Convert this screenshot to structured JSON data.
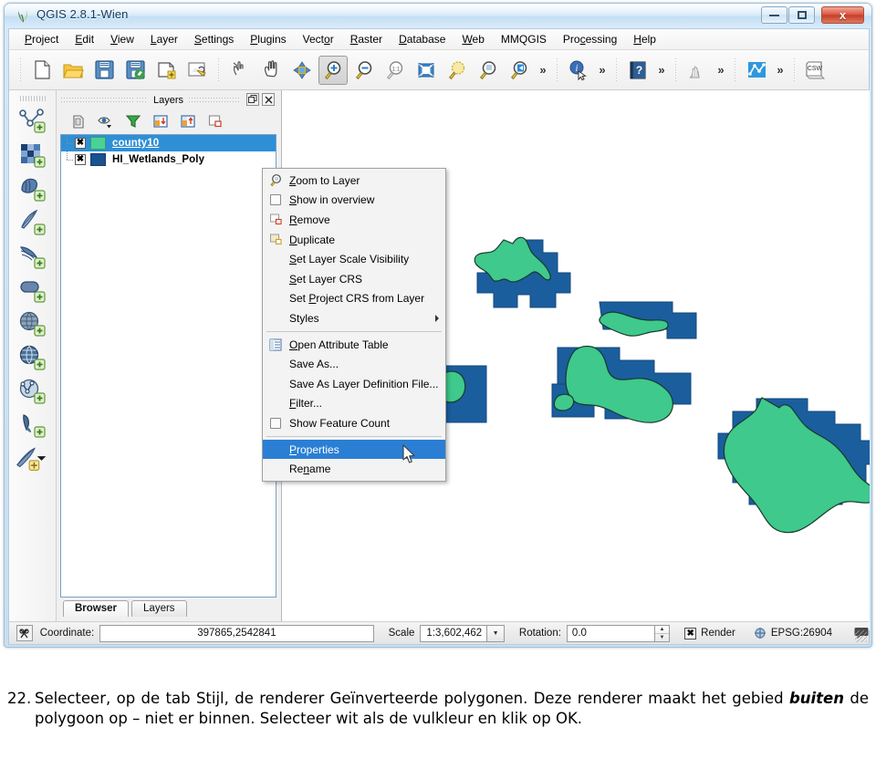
{
  "window": {
    "title": "QGIS 2.8.1-Wien",
    "app_icon": "qgis-logo-icon",
    "minimize_label": "",
    "maximize_label": "",
    "close_label": "x"
  },
  "menu_bar": {
    "items": [
      {
        "label": "Project",
        "mnemonic": "P"
      },
      {
        "label": "Edit",
        "mnemonic": "E"
      },
      {
        "label": "View",
        "mnemonic": "V"
      },
      {
        "label": "Layer",
        "mnemonic": "L"
      },
      {
        "label": "Settings",
        "mnemonic": "S"
      },
      {
        "label": "Plugins",
        "mnemonic": "P"
      },
      {
        "label": "Vector",
        "mnemonic": "o"
      },
      {
        "label": "Raster",
        "mnemonic": "R"
      },
      {
        "label": "Database",
        "mnemonic": "D"
      },
      {
        "label": "Web",
        "mnemonic": "W"
      },
      {
        "label": "MMQGIS",
        "mnemonic": ""
      },
      {
        "label": "Processing",
        "mnemonic": "c"
      },
      {
        "label": "Help",
        "mnemonic": "H"
      }
    ]
  },
  "toolbar": {
    "items": [
      {
        "name": "new-project-icon",
        "type": "icon"
      },
      {
        "name": "open-project-icon",
        "type": "icon"
      },
      {
        "name": "save-project-icon",
        "type": "icon"
      },
      {
        "name": "save-project-as-icon",
        "type": "icon"
      },
      {
        "name": "new-print-composer-icon",
        "type": "icon"
      },
      {
        "name": "composer-manager-icon",
        "type": "icon"
      },
      {
        "name": "separator",
        "type": "sep"
      },
      {
        "name": "touch-zoom-icon",
        "type": "icon"
      },
      {
        "name": "pan-map-icon",
        "type": "icon"
      },
      {
        "name": "pan-to-selection-icon",
        "type": "icon"
      },
      {
        "name": "zoom-in-icon",
        "type": "icon",
        "active": true
      },
      {
        "name": "zoom-out-icon",
        "type": "icon"
      },
      {
        "name": "zoom-native-icon",
        "type": "icon"
      },
      {
        "name": "zoom-full-icon",
        "type": "icon"
      },
      {
        "name": "zoom-to-selection-icon",
        "type": "icon"
      },
      {
        "name": "zoom-to-layer-icon",
        "type": "icon"
      },
      {
        "name": "zoom-last-icon",
        "type": "icon"
      },
      {
        "name": "overflow-chevron",
        "type": "chev"
      },
      {
        "name": "separator",
        "type": "sep"
      },
      {
        "name": "identify-features-icon",
        "type": "icon"
      },
      {
        "name": "overflow-chevron",
        "type": "chev"
      },
      {
        "name": "separator",
        "type": "sep"
      },
      {
        "name": "help-contents-icon",
        "type": "icon"
      },
      {
        "name": "overflow-chevron",
        "type": "chev"
      },
      {
        "name": "separator",
        "type": "sep"
      },
      {
        "name": "histogram-icon",
        "type": "icon"
      },
      {
        "name": "overflow-chevron",
        "type": "chev"
      },
      {
        "name": "separator",
        "type": "sep"
      },
      {
        "name": "graph-tool-icon",
        "type": "icon"
      },
      {
        "name": "overflow-chevron",
        "type": "chev"
      },
      {
        "name": "separator",
        "type": "sep"
      },
      {
        "name": "csw-catalog-icon",
        "type": "icon",
        "label": "CSW"
      }
    ]
  },
  "left_toolbar": {
    "items": [
      {
        "name": "new-shapefile-layer-icon"
      },
      {
        "name": "new-spatialite-layer-icon"
      },
      {
        "name": "add-vector-layer-icon"
      },
      {
        "name": "add-raster-layer-icon"
      },
      {
        "name": "add-delimited-text-layer-icon"
      },
      {
        "name": "add-postgis-layer-icon"
      },
      {
        "name": "add-spatialite-layer-icon"
      },
      {
        "name": "add-wms-layer-icon"
      },
      {
        "name": "add-wfs-layer-icon"
      },
      {
        "name": "add-virtual-layer-icon"
      },
      {
        "name": "add-layer-from-plugin-icon"
      }
    ]
  },
  "layers_panel": {
    "title": "Layers",
    "float_button": "float-panel-icon",
    "close_button": "close-panel-icon",
    "toolbar": [
      {
        "name": "add-group-icon"
      },
      {
        "name": "manage-layer-visibility-icon"
      },
      {
        "name": "filter-legend-icon"
      },
      {
        "name": "expand-all-icon"
      },
      {
        "name": "collapse-all-icon"
      },
      {
        "name": "remove-layer-icon"
      }
    ],
    "layers": [
      {
        "name": "county10",
        "checked": true,
        "check_glyph": "✖",
        "color": "#4ad295",
        "selected": true
      },
      {
        "name": "HI_Wetlands_Poly",
        "checked": true,
        "check_glyph": "✖",
        "color": "#19528f",
        "selected": false
      }
    ],
    "tabs": [
      {
        "label": "Browser",
        "active": true
      },
      {
        "label": "Layers",
        "active": false
      }
    ]
  },
  "context_menu": {
    "items": [
      {
        "label": "Zoom to Layer",
        "mnemonic": "Z",
        "icon": "zoom-to-layer-icon",
        "type": "item"
      },
      {
        "label": "Show in overview",
        "mnemonic": "S",
        "icon": "checkbox-unchecked-icon",
        "type": "item"
      },
      {
        "label": "Remove",
        "mnemonic": "R",
        "icon": "remove-layer-icon",
        "type": "item"
      },
      {
        "label": "Duplicate",
        "mnemonic": "D",
        "icon": "duplicate-layer-icon",
        "type": "item"
      },
      {
        "label": "Set Layer Scale Visibility",
        "mnemonic": "S",
        "icon": "",
        "type": "item"
      },
      {
        "label": "Set Layer CRS",
        "mnemonic": "S",
        "icon": "",
        "type": "item"
      },
      {
        "label": "Set Project CRS from Layer",
        "mnemonic": "P",
        "icon": "",
        "type": "item"
      },
      {
        "label": "Styles",
        "mnemonic": "",
        "icon": "",
        "type": "submenu"
      },
      {
        "type": "separator"
      },
      {
        "label": "Open Attribute Table",
        "mnemonic": "O",
        "icon": "attribute-table-icon",
        "type": "item"
      },
      {
        "label": "Save As...",
        "mnemonic": "",
        "icon": "",
        "type": "item"
      },
      {
        "label": "Save As Layer Definition File...",
        "mnemonic": "",
        "icon": "",
        "type": "item"
      },
      {
        "label": "Filter...",
        "mnemonic": "F",
        "icon": "",
        "type": "item"
      },
      {
        "label": "Show Feature Count",
        "mnemonic": "",
        "icon": "checkbox-unchecked-icon",
        "type": "item"
      },
      {
        "type": "separator"
      },
      {
        "label": "Properties",
        "mnemonic": "P",
        "icon": "",
        "type": "item",
        "highlighted": true
      },
      {
        "label": "Rename",
        "mnemonic": "n",
        "icon": "",
        "type": "item"
      }
    ]
  },
  "status_bar": {
    "locator_icon": "coordinate-capture-icon",
    "coordinate_label": "Coordinate:",
    "coordinate_value": "397865,2542841",
    "scale_label": "Scale",
    "scale_value": "1:3,602,462",
    "rotation_label": "Rotation:",
    "rotation_value": "0.0",
    "render_label": "Render",
    "render_checked": true,
    "render_glyph": "✖",
    "crs_label": "EPSG:26904",
    "crs_icon": "crs-status-icon",
    "messages_icon": "messages-log-icon"
  },
  "map": {
    "background": "#ffffff",
    "polygon_fill": "#3fc98c",
    "polygon_stroke": "#173a2a",
    "wetlands_fill": "#1b5e9e",
    "wetlands_stroke": "#13477a"
  },
  "caption": {
    "number": "22.",
    "part1": "Selecteer, op de tab Stijl, de renderer Geïnverteerde polygonen. Deze renderer maakt het gebied ",
    "emphasis": "buiten",
    "part2": " de polygoon op – niet er binnen. Selecteer wit als de vulkleur en klik op OK."
  }
}
